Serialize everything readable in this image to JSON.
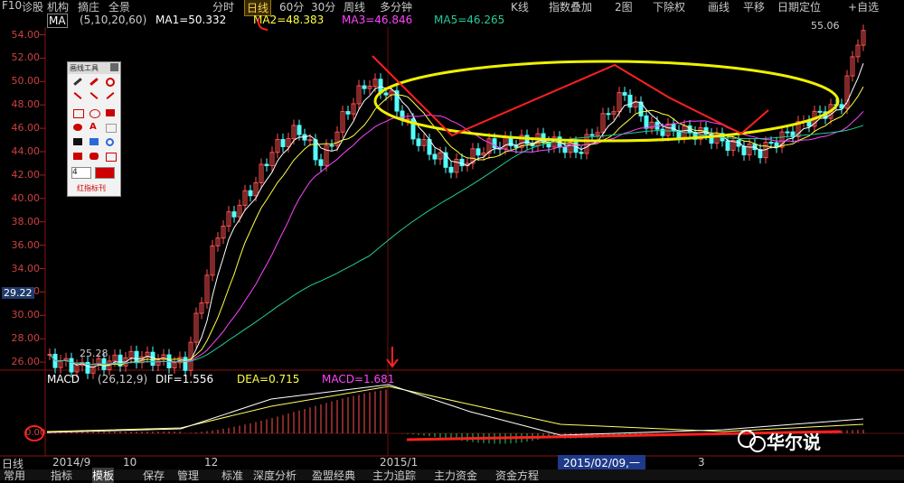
{
  "topbar": {
    "f10": "F10",
    "diagnose": "诊股",
    "institution": "机构",
    "extract": "摘庄",
    "overview": "全景",
    "tabs": [
      "分时",
      "日线",
      "60分",
      "30分",
      "周线",
      "多分钟"
    ],
    "active_tab": "日线",
    "right": [
      "K线",
      "指数叠加",
      "2图",
      "下除权",
      "画线",
      "平移",
      "日期定位",
      "自选"
    ]
  },
  "ma_bar": {
    "name": "MA",
    "params": "(5,10,20,60)",
    "ma1": "MA1=50.332",
    "ma2": "MA2=48.383",
    "ma3": "MA3=46.846",
    "ma5": "MA5=46.265"
  },
  "price_axis": [
    "54.00",
    "52.00",
    "50.00",
    "48.00",
    "46.00",
    "44.00",
    "42.00",
    "40.00",
    "38.00",
    "36.00",
    "34.00",
    "32.00",
    "30.00",
    "28.00",
    "26.00"
  ],
  "labels": {
    "high": "55.06",
    "low": "25.28",
    "current": "29.22"
  },
  "macd_bar": {
    "name": "MACD",
    "params": "(26,12,9)",
    "dif": "DIF=1.556",
    "dea": "DEA=0.715",
    "macd": "MACD=1.681",
    "zero": "0.00"
  },
  "date_axis": [
    "2014/9",
    "10",
    "12",
    "2015/1",
    "3"
  ],
  "date_marker": "2015/02/09,一",
  "bottom": {
    "daily": "日线",
    "tabs": [
      "常用",
      "指标",
      "模板",
      "保存",
      "管理",
      "标准",
      "深度分析",
      "盈盟经典",
      "主力追踪",
      "主力资金",
      "资金方程"
    ]
  },
  "toolbox": {
    "title": "画线工具",
    "width_value": "4",
    "footer": "红指标刊"
  },
  "watermark": "华尔说",
  "colors": {
    "up": "#ff5050",
    "down": "#54ffff",
    "ma1": "#ffffff",
    "ma2": "#ffff44",
    "ma3": "#ff44ff",
    "ma5": "#22cc99"
  }
}
